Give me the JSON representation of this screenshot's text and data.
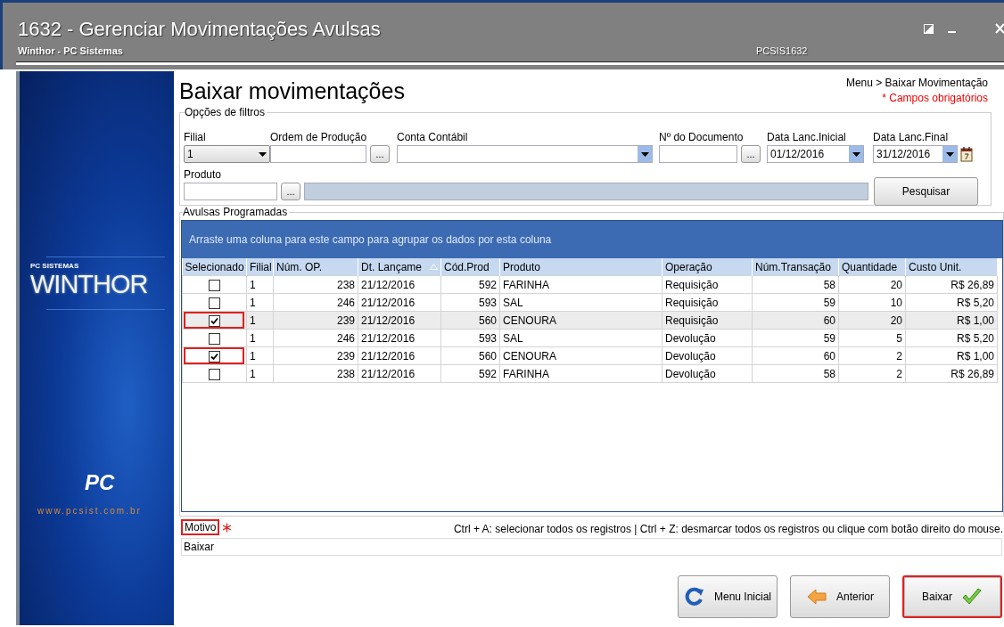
{
  "window": {
    "title": "1632 - Gerenciar Movimentações Avulsas",
    "subtitle": "Winthor - PC Sistemas",
    "code": "PCSIS1632"
  },
  "sidebar": {
    "brand_small": "PC SISTEMAS",
    "logo": "WINTHOR",
    "pc_logo": "PC",
    "url": "www.pcsist.com.br"
  },
  "page": {
    "title": "Baixar movimentações",
    "breadcrumb": "Menu > Baixar Movimentação",
    "required_note": "* Campos obrigatórios"
  },
  "filters": {
    "legend": "Opções de filtros",
    "fields": [
      {
        "kind": "select",
        "label": "Filial",
        "value": "1"
      },
      {
        "kind": "lookup",
        "label": "Ordem de Produção",
        "button": "..."
      },
      {
        "kind": "combo",
        "label": "Conta Contábil"
      },
      {
        "kind": "lookup",
        "label": "Nº do Documento",
        "button": "..."
      },
      {
        "kind": "date",
        "label": "Data Lanc.Inicial",
        "value": "01/12/2016",
        "calendar": false
      },
      {
        "kind": "date",
        "label": "Data Lanc.Final",
        "value": "31/12/2016",
        "calendar": true
      }
    ],
    "product": {
      "label": "Produto",
      "button": "..."
    },
    "search_button": "Pesquisar"
  },
  "grid": {
    "legend": "Avulsas Programadas",
    "group_hint": "Arraste uma coluna para este campo para agrupar os dados por esta coluna",
    "columns": [
      {
        "label": "Selecionado",
        "sorted": false
      },
      {
        "label": "Filial",
        "sorted": false
      },
      {
        "label": "Núm. OP.",
        "sorted": false
      },
      {
        "label": "Dt. Lançame",
        "sorted": true
      },
      {
        "label": "Cód.Prod",
        "sorted": false
      },
      {
        "label": "Produto",
        "sorted": false
      },
      {
        "label": "Operação",
        "sorted": false
      },
      {
        "label": "Núm.Transação",
        "sorted": false
      },
      {
        "label": "Quantidade",
        "sorted": false
      },
      {
        "label": "Custo Unit.",
        "sorted": false
      }
    ],
    "rows": [
      {
        "checked": false,
        "selected": false,
        "highlighted": false,
        "cells": [
          "",
          "1",
          "238",
          "21/12/2016",
          "592",
          "FARINHA",
          "Requisição",
          "58",
          "20",
          "R$ 26,89"
        ]
      },
      {
        "checked": false,
        "selected": false,
        "highlighted": false,
        "cells": [
          "",
          "1",
          "246",
          "21/12/2016",
          "593",
          "SAL",
          "Requisição",
          "59",
          "10",
          "R$ 5,20"
        ]
      },
      {
        "checked": true,
        "selected": true,
        "highlighted": true,
        "cells": [
          "",
          "1",
          "239",
          "21/12/2016",
          "560",
          "CENOURA",
          "Requisição",
          "60",
          "20",
          "R$ 1,00"
        ]
      },
      {
        "checked": false,
        "selected": false,
        "highlighted": false,
        "cells": [
          "",
          "1",
          "246",
          "21/12/2016",
          "593",
          "SAL",
          "Devolução",
          "59",
          "5",
          "R$ 5,20"
        ]
      },
      {
        "checked": true,
        "selected": false,
        "highlighted": true,
        "cells": [
          "",
          "1",
          "239",
          "21/12/2016",
          "560",
          "CENOURA",
          "Devolução",
          "60",
          "2",
          "R$ 1,00"
        ]
      },
      {
        "checked": false,
        "selected": false,
        "highlighted": false,
        "cells": [
          "",
          "1",
          "238",
          "21/12/2016",
          "592",
          "FARINHA",
          "Devolução",
          "58",
          "2",
          "R$ 26,89"
        ]
      }
    ]
  },
  "footer": {
    "hint": "Ctrl + A: selecionar todos os registros | Ctrl + Z: desmarcar todos os registros ou clique com botão direito do mouse.",
    "motivo": {
      "label": "Motivo",
      "highlighted": true,
      "required": true,
      "value": "Baixar"
    },
    "buttons": [
      {
        "label": "Menu Inicial",
        "highlighted": false
      },
      {
        "label": "Anterior",
        "highlighted": false
      },
      {
        "label": "Baixar",
        "highlighted": true
      }
    ]
  }
}
